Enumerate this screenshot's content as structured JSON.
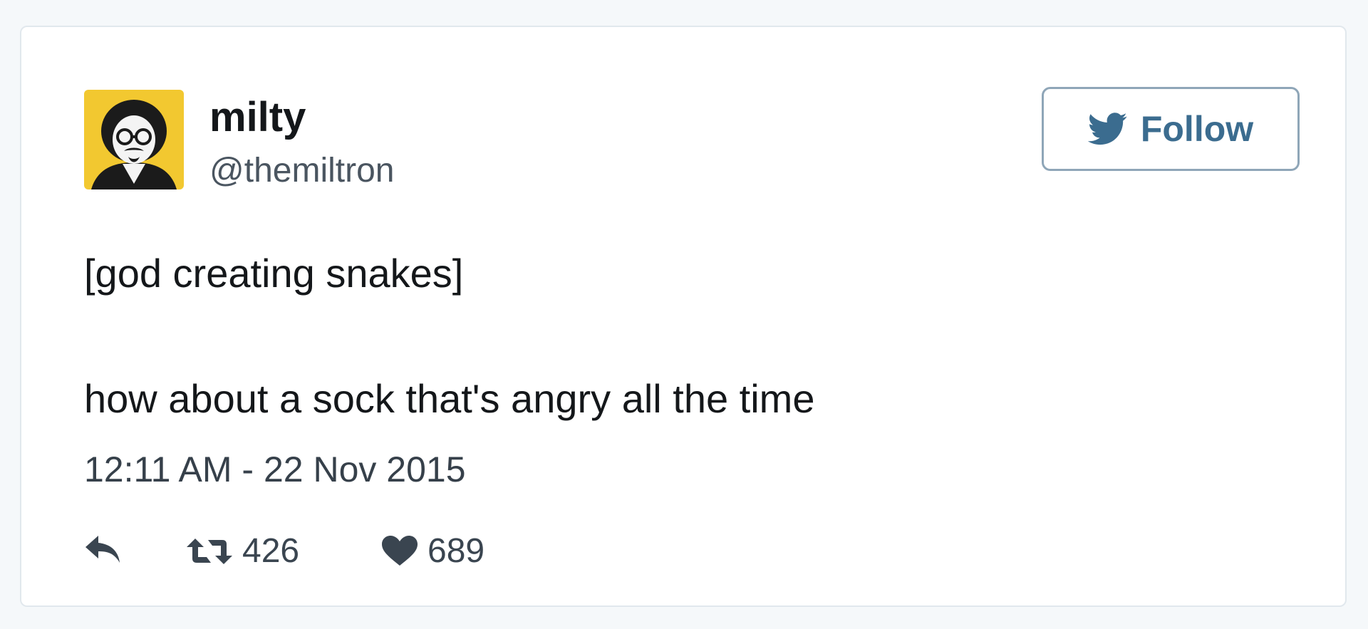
{
  "user": {
    "name": "milty",
    "handle": "@themiltron"
  },
  "follow_button": {
    "label": "Follow",
    "icon": "twitter-bird-icon"
  },
  "tweet": {
    "line1": "[god creating snakes]",
    "line2": "how about a sock that's angry all the time",
    "timestamp": "12:11 AM - 22 Nov 2015"
  },
  "actions": {
    "reply_icon": "reply-icon",
    "retweet_icon": "retweet-icon",
    "retweet_count": "426",
    "like_icon": "heart-icon",
    "like_count": "689"
  },
  "colors": {
    "avatar_background": "#f2c830",
    "follow_accent": "#3b6c8f",
    "text": "#14171a"
  }
}
